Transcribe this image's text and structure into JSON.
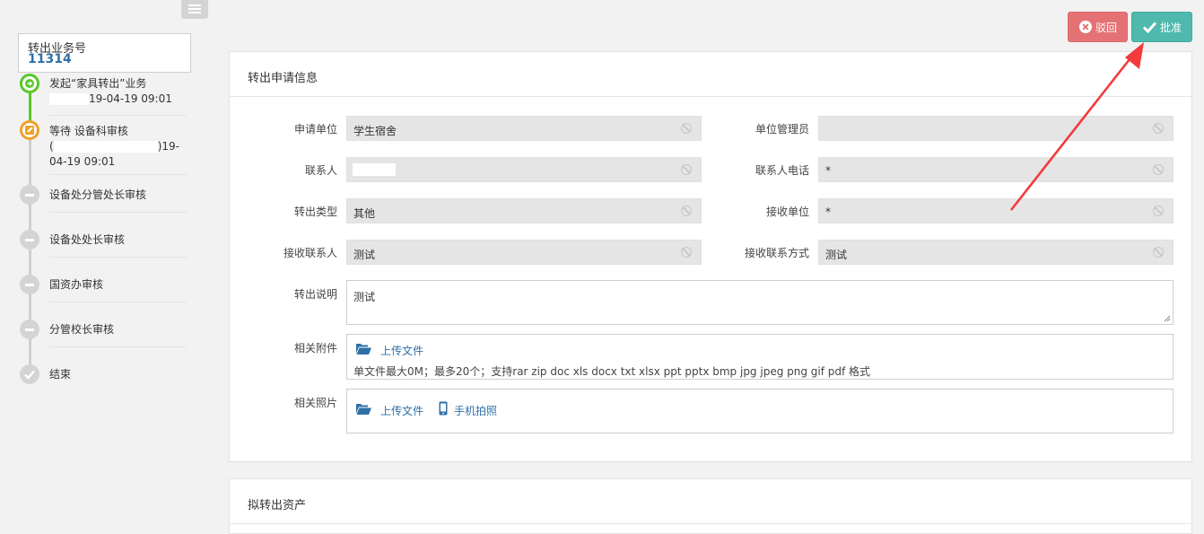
{
  "sidebar": {
    "business_label": "转出业务号",
    "business_no": "11314",
    "steps": [
      {
        "title": "发起“家具转出”业务",
        "detail": "19-04-19 09:01",
        "state": "done"
      },
      {
        "title": "等待 设备科审核",
        "detail_line1": "(",
        "detail_line1_end": ")19-",
        "detail_line2": "04-19 09:01",
        "state": "current"
      },
      {
        "title": "设备处分管处长审核",
        "state": "pending"
      },
      {
        "title": "设备处处长审核",
        "state": "pending"
      },
      {
        "title": "国资办审核",
        "state": "pending"
      },
      {
        "title": "分管校长审核",
        "state": "pending"
      },
      {
        "title": "结束",
        "state": "end"
      }
    ]
  },
  "actions": {
    "reject_label": "驳回",
    "approve_label": "批准"
  },
  "panel_info": {
    "title": "转出申请信息",
    "fields": {
      "apply_unit": {
        "label": "申请单位",
        "value": "学生宿舍"
      },
      "unit_admin": {
        "label": "单位管理员",
        "value": ""
      },
      "contact": {
        "label": "联系人",
        "value": ""
      },
      "contact_phone": {
        "label": "联系人电话",
        "value": "*"
      },
      "transfer_type": {
        "label": "转出类型",
        "value": "其他"
      },
      "receive_unit": {
        "label": "接收单位",
        "value": "*"
      },
      "receive_contact": {
        "label": "接收联系人",
        "value": "测试"
      },
      "receive_contact_method": {
        "label": "接收联系方式",
        "value": "测试"
      },
      "description": {
        "label": "转出说明",
        "value": "测试"
      },
      "attachments": {
        "label": "相关附件",
        "upload_label": "上传文件",
        "hint": "单文件最大0M；最多20个；支持rar zip doc xls docx txt xlsx ppt pptx bmp jpg jpeg png gif pdf 格式"
      },
      "photos": {
        "label": "相关照片",
        "upload_label": "上传文件",
        "phone_label": "手机拍照"
      }
    }
  },
  "panel_assets": {
    "title": "拟转出资产"
  },
  "colors": {
    "done": "#59c829",
    "current": "#f0a02a",
    "pending": "#cfcfcf",
    "reject": "#e47274",
    "approve": "#4fb9ad",
    "link": "#2f6fa7",
    "annotation_arrow": "#f23b3b"
  }
}
